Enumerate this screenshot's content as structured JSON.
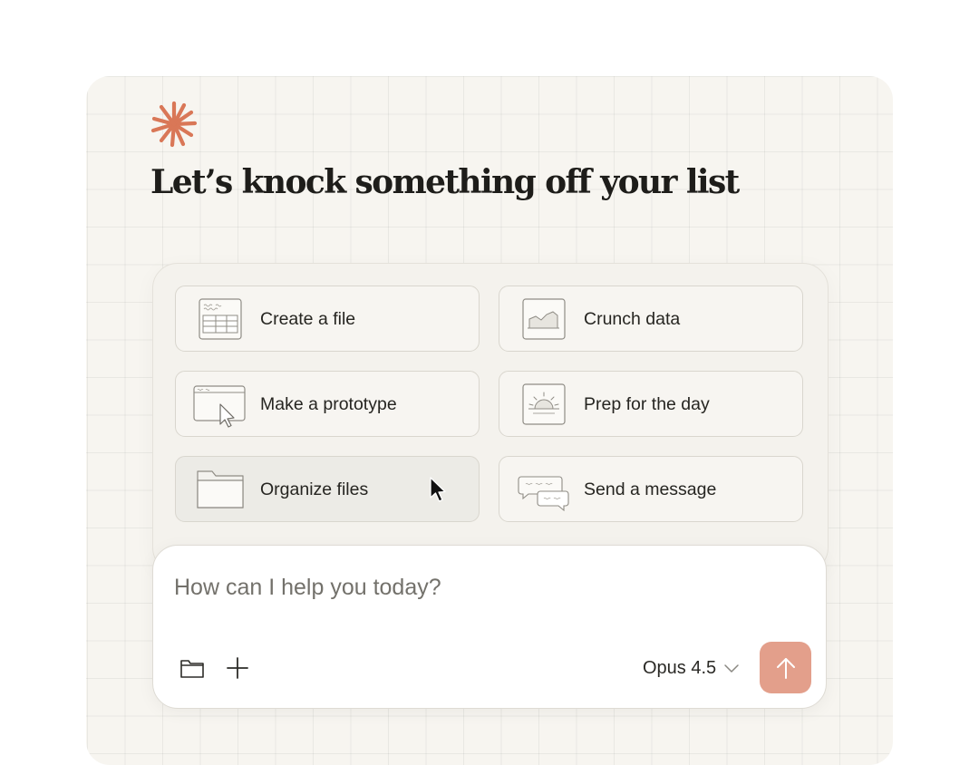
{
  "heading": "Let’s knock something off your list",
  "actions": [
    {
      "label": "Create a file",
      "icon": "spreadsheet-icon"
    },
    {
      "label": "Crunch data",
      "icon": "chart-icon"
    },
    {
      "label": "Make a prototype",
      "icon": "browser-window-icon"
    },
    {
      "label": "Prep for the day",
      "icon": "sunrise-icon"
    },
    {
      "label": "Organize files",
      "icon": "folder-icon"
    },
    {
      "label": "Send a message",
      "icon": "chat-bubbles-icon"
    }
  ],
  "composer": {
    "placeholder": "How can I help you today?",
    "model": "Opus 4.5"
  },
  "colors": {
    "accent": "#d97757",
    "send_button": "#e39f8b",
    "panel_bg": "#f7f5f0"
  }
}
